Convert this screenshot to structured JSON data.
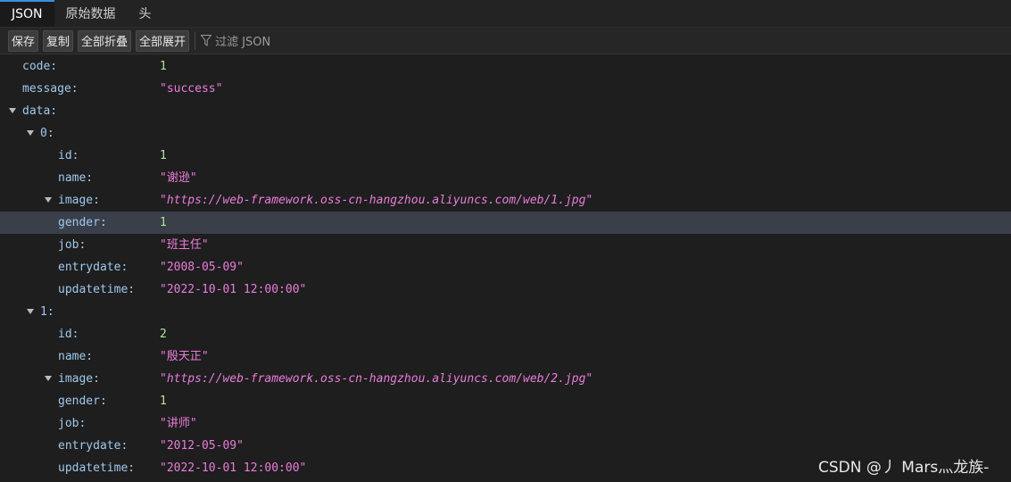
{
  "tabs": [
    {
      "label": "JSON",
      "active": true
    },
    {
      "label": "原始数据",
      "active": false
    },
    {
      "label": "头",
      "active": false
    }
  ],
  "toolbar": {
    "save_label": "保存",
    "copy_label": "复制",
    "collapse_all_label": "全部折叠",
    "expand_all_label": "全部展开",
    "filter_placeholder": "过滤 JSON",
    "filter_icon": "funnel-icon"
  },
  "tree": {
    "code": {
      "key": "code:",
      "value": "1"
    },
    "message": {
      "key": "message:",
      "value": "\"success\""
    },
    "data": {
      "key": "data:"
    },
    "items": [
      {
        "index": "0:",
        "id": {
          "key": "id:",
          "value": "1"
        },
        "name": {
          "key": "name:",
          "value": "\"谢逊\""
        },
        "image": {
          "key": "image:",
          "value": "\"https://web-framework.oss-cn-hangzhou.aliyuncs.com/web/1.jpg\""
        },
        "gender": {
          "key": "gender:",
          "value": "1"
        },
        "job": {
          "key": "job:",
          "value": "\"班主任\""
        },
        "entrydate": {
          "key": "entrydate:",
          "value": "\"2008-05-09\""
        },
        "updatetime": {
          "key": "updatetime:",
          "value": "\"2022-10-01 12:00:00\""
        }
      },
      {
        "index": "1:",
        "id": {
          "key": "id:",
          "value": "2"
        },
        "name": {
          "key": "name:",
          "value": "\"殷天正\""
        },
        "image": {
          "key": "image:",
          "value": "\"https://web-framework.oss-cn-hangzhou.aliyuncs.com/web/2.jpg\""
        },
        "gender": {
          "key": "gender:",
          "value": "1"
        },
        "job": {
          "key": "job:",
          "value": "\"讲师\""
        },
        "entrydate": {
          "key": "entrydate:",
          "value": "\"2012-05-09\""
        },
        "updatetime": {
          "key": "updatetime:",
          "value": "\"2022-10-01 12:00:00\""
        }
      }
    ]
  },
  "watermark": "CSDN @丿 Mars灬龙族-",
  "colors": {
    "background": "#1e1e1e",
    "key": "#9fc9ee",
    "number": "#b5e0a0",
    "string": "#eb7cdb",
    "active_tab_accent": "#3a8fe6",
    "highlight_row": "#3a3f4a"
  }
}
